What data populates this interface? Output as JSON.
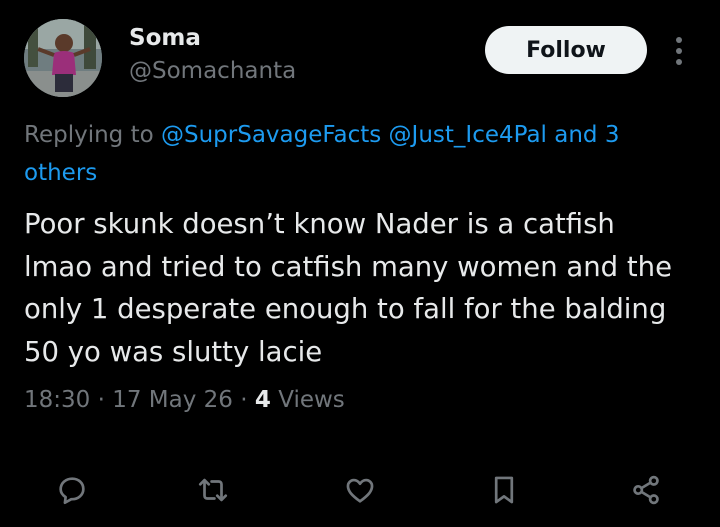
{
  "user": {
    "name": "Soma",
    "handle": "@Somachanta",
    "follow_label": "Follow"
  },
  "reply_context": {
    "prefix": "Replying to",
    "mentions": [
      "@SuprSavageFacts",
      "@Just_Ice4Pal"
    ],
    "and_others": "and 3 others"
  },
  "post": {
    "text": "Poor skunk doesn’t know Nader is a catfish lmao and tried to catfish many women and the only 1 desperate enough to fall for the balding 50 yo was slutty lacie"
  },
  "meta": {
    "time": "18:30",
    "date": "17 May 26",
    "views_count": "4",
    "views_label": "Views",
    "separator": "·"
  },
  "actions": {
    "icons": [
      "reply-icon",
      "repost-icon",
      "like-icon",
      "bookmark-icon",
      "share-icon"
    ]
  },
  "colors": {
    "background": "#000000",
    "text": "#e7e9ea",
    "secondary": "#71767b",
    "link": "#1d9bf0",
    "button_bg": "#eff3f4"
  }
}
